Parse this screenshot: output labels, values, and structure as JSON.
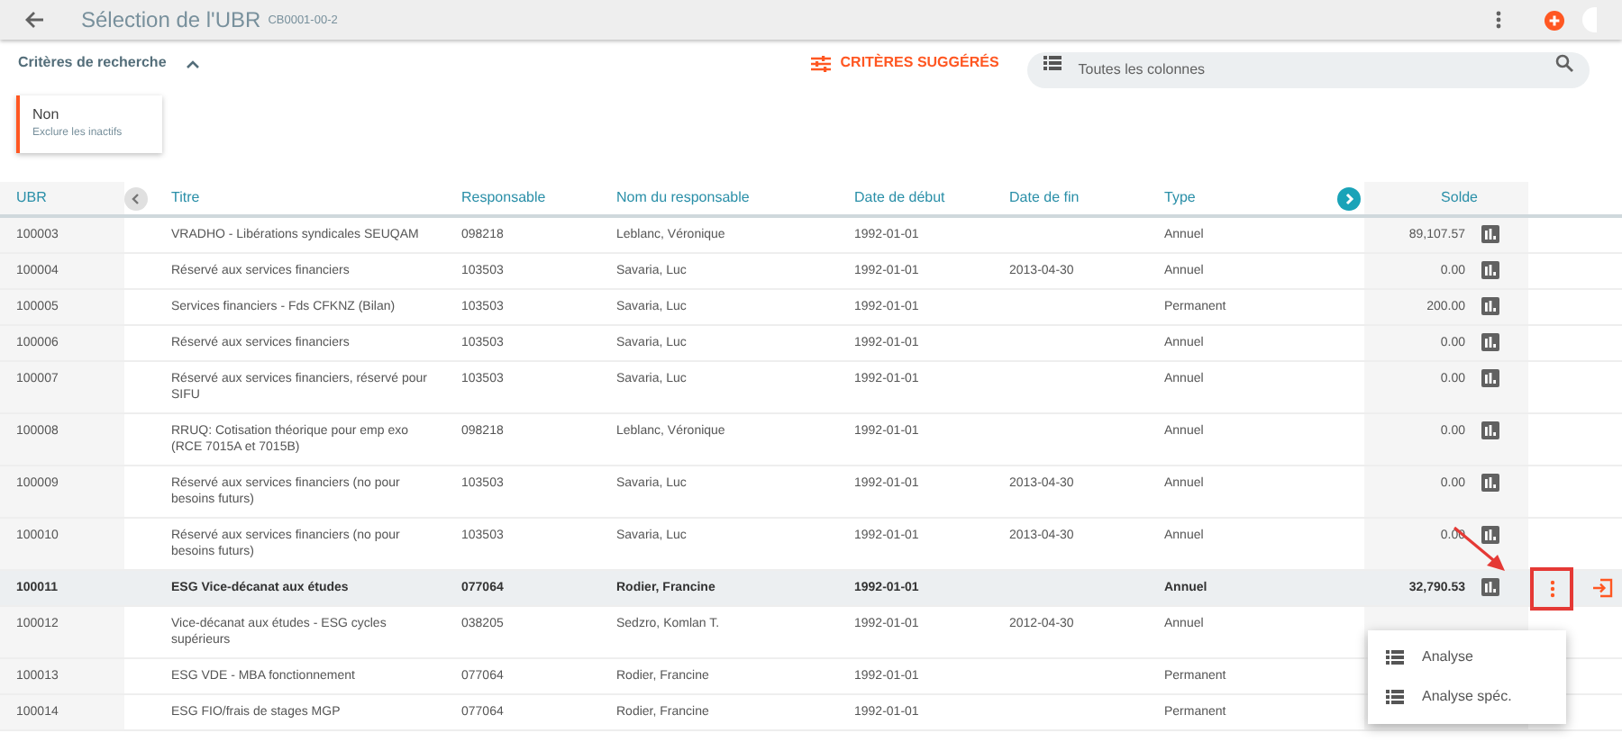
{
  "header": {
    "title": "Sélection de l'UBR",
    "code": "CB0001-00-2"
  },
  "criteria": {
    "label": "Critères de recherche",
    "expanded": true
  },
  "suggested_button": "CRITÈRES SUGGÉRÉS",
  "search": {
    "placeholder": "Toutes les colonnes"
  },
  "filter_chip": {
    "value": "Non",
    "label": "Exclure les inactifs"
  },
  "table": {
    "columns": [
      "UBR",
      "Titre",
      "Responsable",
      "Nom du responsable",
      "Date de début",
      "Date de fin",
      "Type",
      "Solde"
    ],
    "rows": [
      {
        "ubr": "100003",
        "titre": "VRADHO - Libérations syndicales SEUQAM",
        "responsable": "098218",
        "nom": "Leblanc, Véronique",
        "debut": "1992-01-01",
        "fin": "",
        "type": "Annuel",
        "solde": "89,107.57",
        "selected": false
      },
      {
        "ubr": "100004",
        "titre": "Réservé aux services financiers",
        "responsable": "103503",
        "nom": "Savaria, Luc",
        "debut": "1992-01-01",
        "fin": "2013-04-30",
        "type": "Annuel",
        "solde": "0.00",
        "selected": false
      },
      {
        "ubr": "100005",
        "titre": "Services financiers - Fds CFKNZ (Bilan)",
        "responsable": "103503",
        "nom": "Savaria, Luc",
        "debut": "1992-01-01",
        "fin": "",
        "type": "Permanent",
        "solde": "200.00",
        "selected": false
      },
      {
        "ubr": "100006",
        "titre": "Réservé aux services financiers",
        "responsable": "103503",
        "nom": "Savaria, Luc",
        "debut": "1992-01-01",
        "fin": "",
        "type": "Annuel",
        "solde": "0.00",
        "selected": false
      },
      {
        "ubr": "100007",
        "titre": "Réservé aux services financiers, réservé pour SIFU",
        "responsable": "103503",
        "nom": "Savaria, Luc",
        "debut": "1992-01-01",
        "fin": "",
        "type": "Annuel",
        "solde": "0.00",
        "selected": false
      },
      {
        "ubr": "100008",
        "titre": "RRUQ: Cotisation théorique pour emp exo (RCE 7015A et 7015B)",
        "responsable": "098218",
        "nom": "Leblanc, Véronique",
        "debut": "1992-01-01",
        "fin": "",
        "type": "Annuel",
        "solde": "0.00",
        "selected": false
      },
      {
        "ubr": "100009",
        "titre": "Réservé aux services financiers (no pour besoins futurs)",
        "responsable": "103503",
        "nom": "Savaria, Luc",
        "debut": "1992-01-01",
        "fin": "2013-04-30",
        "type": "Annuel",
        "solde": "0.00",
        "selected": false
      },
      {
        "ubr": "100010",
        "titre": "Réservé aux services financiers (no pour besoins futurs)",
        "responsable": "103503",
        "nom": "Savaria, Luc",
        "debut": "1992-01-01",
        "fin": "2013-04-30",
        "type": "Annuel",
        "solde": "0.00",
        "selected": false
      },
      {
        "ubr": "100011",
        "titre": "ESG Vice-décanat aux études",
        "responsable": "077064",
        "nom": "Rodier, Francine",
        "debut": "1992-01-01",
        "fin": "",
        "type": "Annuel",
        "solde": "32,790.53",
        "selected": true
      },
      {
        "ubr": "100012",
        "titre": "Vice-décanat aux études - ESG cycles supérieurs",
        "responsable": "038205",
        "nom": "Sedzro, Komlan T.",
        "debut": "1992-01-01",
        "fin": "2012-04-30",
        "type": "Annuel",
        "solde": "",
        "selected": false
      },
      {
        "ubr": "100013",
        "titre": "ESG VDE - MBA fonctionnement",
        "responsable": "077064",
        "nom": "Rodier, Francine",
        "debut": "1992-01-01",
        "fin": "",
        "type": "Permanent",
        "solde": "",
        "selected": false
      },
      {
        "ubr": "100014",
        "titre": "ESG FIO/frais de stages MGP",
        "responsable": "077064",
        "nom": "Rodier, Francine",
        "debut": "1992-01-01",
        "fin": "",
        "type": "Permanent",
        "solde": "",
        "selected": false
      }
    ]
  },
  "row_menu": {
    "items": [
      "Analyse",
      "Analyse spéc."
    ]
  }
}
